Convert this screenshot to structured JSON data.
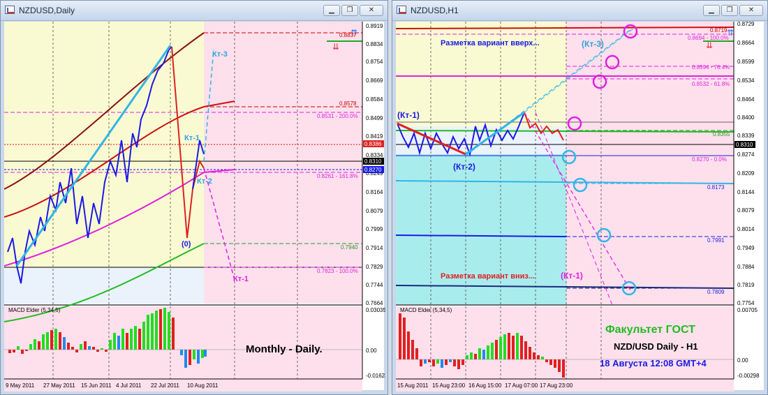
{
  "windows": {
    "left": {
      "title": "NZDUSD,Daily",
      "price_labels": [
        "0.8919",
        "0.8834",
        "0.8754",
        "0.8669",
        "0.8584",
        "0.8499",
        "0.8419",
        "0.8334",
        "0.8249",
        "0.8164",
        "0.8079",
        "0.7999",
        "0.7914",
        "0.7829",
        "0.7744",
        "0.7664"
      ],
      "price_highlight_red": "0.8386",
      "price_highlight_black": "0.8310",
      "price_highlight_blue": "0.8270",
      "macd_label": "MACD Elder (5,34,5)",
      "macd_scale": [
        "0.03035",
        "0.00",
        "-0.01623"
      ],
      "date_labels": [
        "9 May 2011",
        "27 May 2011",
        "15 Jun 2011",
        "4 Jul 2011",
        "22 Jul 2011",
        "10 Aug 2011"
      ],
      "annotations": {
        "kt3": "Кт-3",
        "kt1": "Кт-1",
        "kt2": "Кт-2",
        "zero": "(0)",
        "kt1_low": "Кт-1",
        "level_8837": "0.8837",
        "level_8578": "0.8578",
        "level_8531": "0.8531 - 200.0%",
        "level_8261": "0.8261 - 161.8%",
        "level_7940": "0.7940",
        "level_7823": "0.7823 - 100.0%",
        "caption": "Monthly - Daily."
      }
    },
    "right": {
      "title": "NZDUSD,H1",
      "price_labels": [
        "0.8729",
        "0.8664",
        "0.8599",
        "0.8534",
        "0.8464",
        "0.8400",
        "0.8339",
        "0.8274",
        "0.8209",
        "0.8144",
        "0.8079",
        "0.8014",
        "0.7949",
        "0.7884",
        "0.7819",
        "0.7754"
      ],
      "price_highlight_black": "0.8310",
      "macd_label": "MACD Elder (5,34,5)",
      "macd_scale": [
        "0.00705",
        "0.00",
        "-0.00298"
      ],
      "date_labels": [
        "15 Aug 2011",
        "15 Aug 23:00",
        "16 Aug 15:00",
        "17 Aug 07:00",
        "17 Aug 23:00"
      ],
      "annotations": {
        "up_text": "Разметка вариант вверх...",
        "down_text": "Разметка вариант вниз...",
        "kt3": "(Кт-3)",
        "kt1": "(Кт-1)",
        "kt2": "(Кт-2)",
        "kt1_low": "(Кт-1)",
        "level_8719": "0.8719",
        "level_8694": "0.8694 - 100.0%",
        "level_8594": "0.8594 - 76.4%",
        "level_8532": "0.8532 - 61.8%",
        "level_8355": "0.8355",
        "level_8270": "0.8270 - 0.0%",
        "level_8173": "0.8173",
        "level_7991": "0.7991",
        "level_7809": "0.7809",
        "faculty": "Факультет ГОСТ",
        "pair": "NZD/USD Daily - H1",
        "date": "18 Августа 12:08 GMT+4"
      }
    }
  },
  "colors": {
    "yellow_zone": "#fafad2",
    "pink_zone": "#fde0ec",
    "cyan_zone": "#a9ecee",
    "price_line": "#1a1ae6",
    "fib_magenta": "#e020e0",
    "caption_green": "#22bb22",
    "caption_blue": "#1a1ae6"
  }
}
